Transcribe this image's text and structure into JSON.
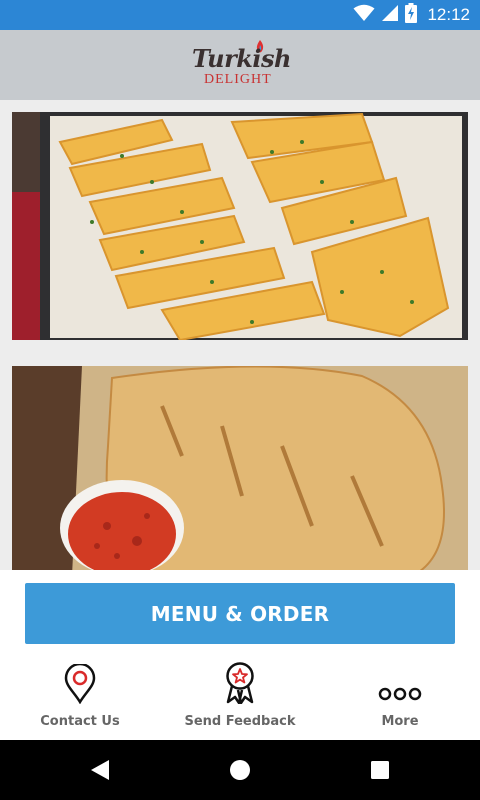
{
  "status_bar": {
    "time": "12:12",
    "icons": [
      "wifi-icon",
      "cell-signal-icon",
      "battery-charging-icon"
    ],
    "background_color": "#2c86d5"
  },
  "header": {
    "logo_word1": "Turkish",
    "logo_word2": "DELIGHT",
    "background_color": "#c6cace"
  },
  "cards": [
    {
      "name": "garlic-bread-image",
      "description_icon": "photo"
    },
    {
      "name": "calzone-image",
      "description_icon": "photo"
    }
  ],
  "menu_order": {
    "label": "MENU & ORDER",
    "color": "#3d9ad8"
  },
  "bottom_nav": {
    "contact": {
      "label": "Contact Us",
      "icon": "map-pin-icon"
    },
    "feedback": {
      "label": "Send Feedback",
      "icon": "award-ribbon-icon"
    },
    "more": {
      "label": "More",
      "icon": "more-dots-icon"
    }
  },
  "system_nav": {
    "icons": [
      "back-icon",
      "home-icon",
      "recents-icon"
    ]
  }
}
